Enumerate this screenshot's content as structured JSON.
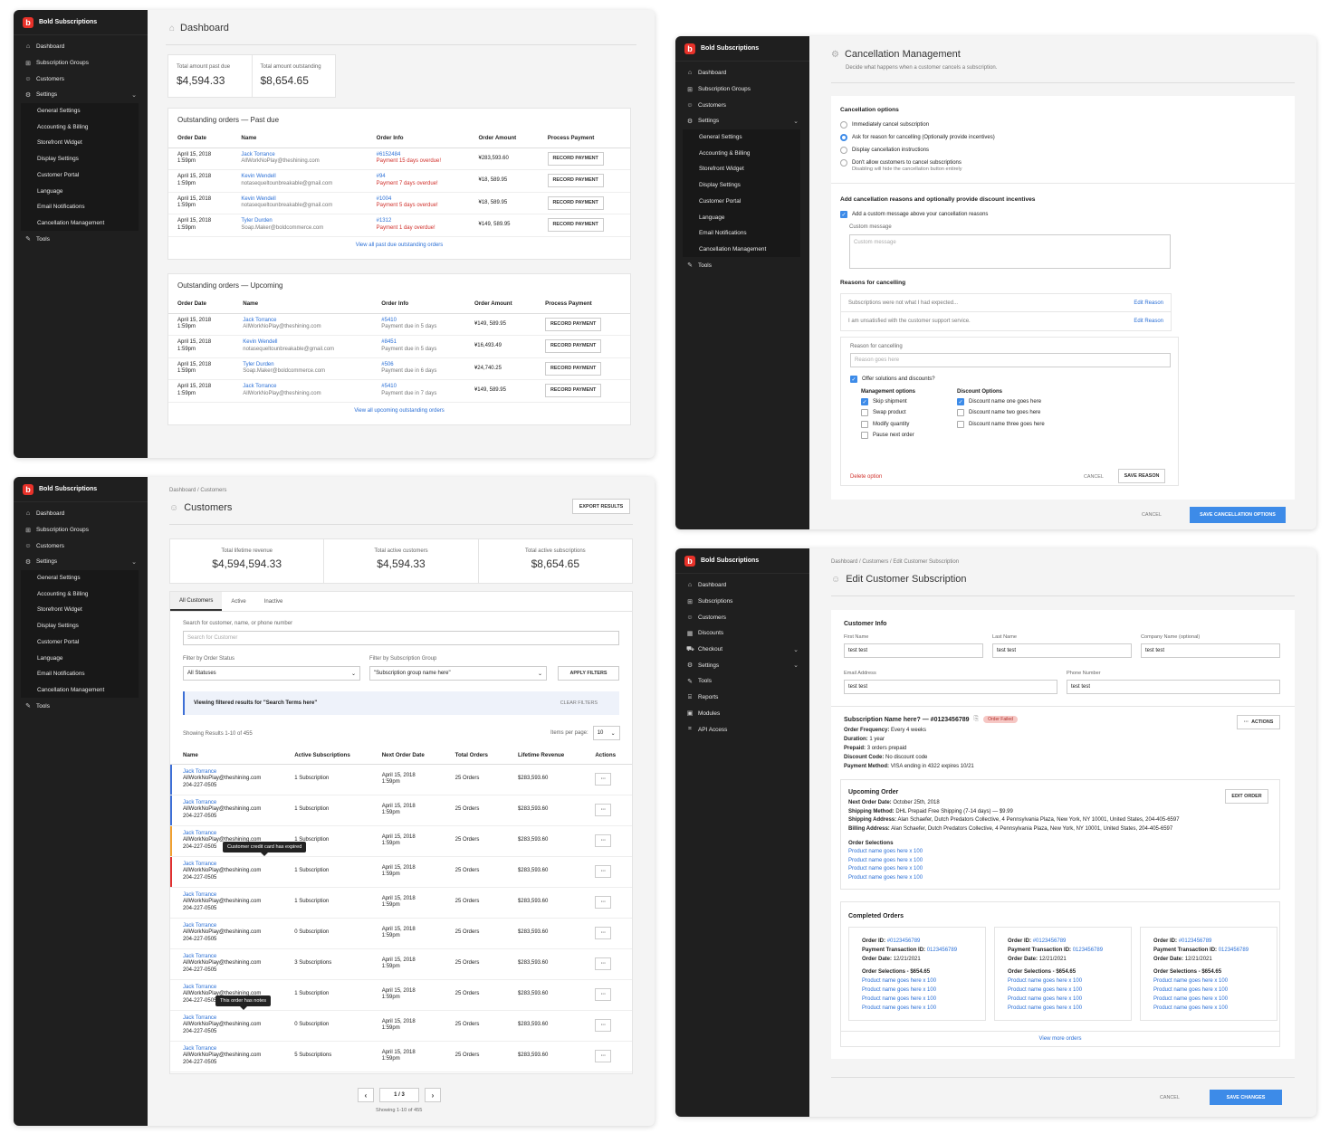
{
  "brand": "Bold Subscriptions",
  "nav": {
    "dashboard": "Dashboard",
    "subscription_groups": "Subscription Groups",
    "customers": "Customers",
    "settings": "Settings",
    "tools": "Tools",
    "subscriptions": "Subscriptions",
    "discounts": "Discounts",
    "checkout": "Checkout",
    "reports": "Reports",
    "modules": "Modules",
    "api_access": "API Access"
  },
  "settings_sub": [
    "General Settings",
    "Accounting & Billing",
    "Storefront Widget",
    "Display Settings",
    "Customer Portal",
    "Language",
    "Email Notifications",
    "Cancellation Management"
  ],
  "dashboard": {
    "title": "Dashboard",
    "stats": [
      {
        "label": "Total amount past due",
        "value": "$4,594.33"
      },
      {
        "label": "Total amount outstanding",
        "value": "$8,654.65"
      }
    ],
    "past_due": {
      "title": "Outstanding orders — Past due",
      "headers": [
        "Order Date",
        "Name",
        "Order Info",
        "Order Amount",
        "Process Payment"
      ],
      "rows": [
        {
          "date": "April 15, 2018",
          "time": "1:59pm",
          "name": "Jack Torrance",
          "email": "AllWorkNoPlay@theshining.com",
          "order": "#6152484",
          "status": "Payment 15 days overdue!",
          "amount": "¥283,593.60",
          "action": "RECORD PAYMENT"
        },
        {
          "date": "April 15, 2018",
          "time": "1:59pm",
          "name": "Kevin Wendell",
          "email": "notasequeltounbreakable@gmail.com",
          "order": "#94",
          "status": "Payment 7 days overdue!",
          "amount": "¥18, 589.95",
          "action": "RECORD PAYMENT"
        },
        {
          "date": "April 15, 2018",
          "time": "1:59pm",
          "name": "Kevin Wendell",
          "email": "notasequeltounbreakable@gmail.com",
          "order": "#1004",
          "status": "Payment 5 days overdue!",
          "amount": "¥18, 589.95",
          "action": "RECORD PAYMENT"
        },
        {
          "date": "April 15, 2018",
          "time": "1:59pm",
          "name": "Tyler Durden",
          "email": "Soap.Maker@boldcommerce.com",
          "order": "#1312",
          "status": "Payment 1 day overdue!",
          "amount": "¥149, 589.95",
          "action": "RECORD PAYMENT"
        }
      ],
      "view_all": "View all past due outstanding orders"
    },
    "upcoming": {
      "title": "Outstanding orders — Upcoming",
      "headers": [
        "Order Date",
        "Name",
        "Order Info",
        "Order Amount",
        "Process Payment"
      ],
      "rows": [
        {
          "date": "April 15, 2018",
          "time": "1:59pm",
          "name": "Jack Torrance",
          "email": "AllWorkNoPlay@theshining.com",
          "order": "#5410",
          "status": "Payment due in 5 days",
          "amount": "¥149, 589.95",
          "action": "RECORD PAYMENT"
        },
        {
          "date": "April 15, 2018",
          "time": "1:59pm",
          "name": "Kevin Wendell",
          "email": "notasequeltounbreakable@gmail.com",
          "order": "#8451",
          "status": "Payment due in 5 days",
          "amount": "¥16,493.49",
          "action": "RECORD PAYMENT"
        },
        {
          "date": "April 15, 2018",
          "time": "1:59pm",
          "name": "Tyler Durden",
          "email": "Soap.Maker@boldcommerce.com",
          "order": "#506",
          "status": "Payment due in 6 days",
          "amount": "¥24,740.25",
          "action": "RECORD PAYMENT"
        },
        {
          "date": "April 15, 2018",
          "time": "1:59pm",
          "name": "Jack Torrance",
          "email": "AllWorkNoPlay@theshining.com",
          "order": "#5410",
          "status": "Payment due in 7 days",
          "amount": "¥149, 589.95",
          "action": "RECORD PAYMENT"
        }
      ],
      "view_all": "View all upcoming outstanding orders"
    }
  },
  "cancel": {
    "title": "Cancellation Management",
    "subtitle": "Decide what happens when a customer cancels a subscription.",
    "options_title": "Cancellation options",
    "options": [
      "Immediately cancel subscription",
      "Ask for reason for cancelling (Optionally provide incentives)",
      "Display cancellation instructions",
      "Don't allow customers to cancel subscriptions"
    ],
    "options_note": "Disabling will hide the cancellation button entirely",
    "reasons_section": "Add cancellation reasons and optionally provide discount incentives",
    "custom_msg_cb": "Add a custom message above your cancellation reasons",
    "custom_msg_label": "Custom message",
    "custom_msg_ph": "Custom message",
    "reasons_title": "Reasons for cancelling",
    "reasons": [
      "Subscriptions were not what I had expected...",
      "I am unsatisfied with the customer support service."
    ],
    "edit_reason": "Edit Reason",
    "reason_label": "Reason for cancelling",
    "reason_ph": "Reason goes here",
    "offer": "Offer solutions and discounts?",
    "mgmt_title": "Management options",
    "mgmt": [
      "Skip shipment",
      "Swap product",
      "Modify quantity",
      "Pause next order"
    ],
    "disc_title": "Discount Options",
    "disc": [
      "Discount name one goes here",
      "Discount name two goes here",
      "Discount name three goes here"
    ],
    "delete": "Delete option",
    "cancel": "CANCEL",
    "save_reason": "SAVE REASON",
    "save": "SAVE CANCELLATION OPTIONS"
  },
  "customers": {
    "crumb": "Dashboard / Customers",
    "title": "Customers",
    "export": "EXPORT RESULTS",
    "stats": [
      {
        "label": "Total lifetime revenue",
        "value": "$4,594,594.33"
      },
      {
        "label": "Total active customers",
        "value": "$4,594.33"
      },
      {
        "label": "Total active subscriptions",
        "value": "$8,654.65"
      }
    ],
    "tabs": [
      "All Customers",
      "Active",
      "Inactive"
    ],
    "search_label": "Search for customer, name, or phone number",
    "search_ph": "Search for Customer",
    "filter_status_label": "Filter by Order Status",
    "filter_status": "All Statuses",
    "filter_group_label": "Filter by Subscription Group",
    "filter_group": "\"Subscription group name here\"",
    "apply": "APPLY FILTERS",
    "banner": "Viewing filtered results for \"Search Terms here\"",
    "clear": "CLEAR FILTERS",
    "showing": "Showing Results 1-10 of 455",
    "per_page_label": "Items per page:",
    "per_page": "10",
    "headers": [
      "Name",
      "Active Subscriptions",
      "Next Order Date",
      "Total Orders",
      "Lifetime Revenue",
      "Actions"
    ],
    "rows": [
      {
        "name": "Jack Torrance",
        "email": "AllWorkNoPlay@theshining.com",
        "phone": "204-227-0505",
        "subs": "1 Subscription",
        "date": "April 15, 2018",
        "time": "1:59pm",
        "orders": "25 Orders",
        "rev": "$283,593.60",
        "flag": "#3d6fd6"
      },
      {
        "name": "Jack Torrance",
        "email": "AllWorkNoPlay@theshining.com",
        "phone": "204-227-0505",
        "subs": "1 Subscription",
        "date": "April 15, 2018",
        "time": "1:59pm",
        "orders": "25 Orders",
        "rev": "$283,593.60",
        "flag": "#3d6fd6"
      },
      {
        "name": "Jack Torrance",
        "email": "AllWorkNoPlay@theshining.com",
        "phone": "204-227-0505",
        "subs": "1 Subscription",
        "date": "April 15, 2018",
        "time": "1:59pm",
        "orders": "25 Orders",
        "rev": "$283,593.60",
        "flag": "#f0a030"
      },
      {
        "name": "Jack Torrance",
        "email": "AllWorkNoPlay@theshining.com",
        "phone": "204-227-0505",
        "subs": "1 Subscription",
        "date": "April 15, 2018",
        "time": "1:59pm",
        "orders": "25 Orders",
        "rev": "$283,593.60",
        "flag": "#e03030"
      },
      {
        "name": "Jack Torrance",
        "email": "AllWorkNoPlay@theshining.com",
        "phone": "204-227-0505",
        "subs": "1 Subscription",
        "date": "April 15, 2018",
        "time": "1:59pm",
        "orders": "25 Orders",
        "rev": "$283,593.60",
        "flag": ""
      },
      {
        "name": "Jack Torrance",
        "email": "AllWorkNoPlay@theshining.com",
        "phone": "204-227-0505",
        "subs": "0 Subscription",
        "date": "April 15, 2018",
        "time": "1:59pm",
        "orders": "25 Orders",
        "rev": "$283,593.60",
        "flag": ""
      },
      {
        "name": "Jack Torrance",
        "email": "AllWorkNoPlay@theshining.com",
        "phone": "204-227-0505",
        "subs": "3 Subscriptions",
        "date": "April 15, 2018",
        "time": "1:59pm",
        "orders": "25 Orders",
        "rev": "$283,593.60",
        "flag": ""
      },
      {
        "name": "Jack Torrance",
        "email": "AllWorkNoPlay@theshining.com",
        "phone": "204-227-0505",
        "subs": "1 Subscription",
        "date": "April 15, 2018",
        "time": "1:59pm",
        "orders": "25 Orders",
        "rev": "$283,593.60",
        "flag": ""
      },
      {
        "name": "Jack Torrance",
        "email": "AllWorkNoPlay@theshining.com",
        "phone": "204-227-0505",
        "subs": "0 Subscription",
        "date": "April 15, 2018",
        "time": "1:59pm",
        "orders": "25 Orders",
        "rev": "$283,593.60",
        "flag": ""
      },
      {
        "name": "Jack Torrance",
        "email": "AllWorkNoPlay@theshining.com",
        "phone": "204-227-0505",
        "subs": "5 Subscriptions",
        "date": "April 15, 2018",
        "time": "1:59pm",
        "orders": "25 Orders",
        "rev": "$283,593.60",
        "flag": ""
      }
    ],
    "tip_card": "Customer credit card has expired",
    "tip_notes": "This order has notes",
    "page": "1 / 3",
    "showing_bottom": "Showing 1-10 of 455"
  },
  "edit": {
    "crumb": "Dashboard / Customers / Edit Customer Subscription",
    "title": "Edit Customer Subscription",
    "info_title": "Customer Info",
    "first_label": "First Name",
    "first": "test test",
    "last_label": "Last Name",
    "last": "test test",
    "company_label": "Company Name (optional)",
    "company": "test test",
    "email_label": "Email Address",
    "email": "test test",
    "phone_label": "Phone Number",
    "phone": "test test",
    "sub_title": "Subscription Name here? — #0123456789",
    "badge": "Order Failed",
    "actions": "ACTIONS",
    "details": [
      [
        "Order Frequency:",
        "Every 4 weeks"
      ],
      [
        "Duration:",
        "1 year"
      ],
      [
        "Prepaid:",
        "3 orders prepaid"
      ],
      [
        "Discount Code:",
        "No discount code"
      ],
      [
        "Payment Method:",
        "VISA ending in 4322 expires 10/21"
      ]
    ],
    "upcoming_title": "Upcoming Order",
    "edit_order": "EDIT ORDER",
    "up_details": [
      [
        "Next Order Date:",
        "October 25th, 2018"
      ],
      [
        "Shipping Method:",
        "DHL Prepaid Free Shipping (7-14 days) — $9.99"
      ],
      [
        "Shipping Address:",
        "Alan Schaefer, Dutch Predators Collective, 4 Pennsylvania Plaza, New York, NY 10001, United States, 204-405-6597"
      ],
      [
        "Billing Address:",
        "Alan Schaefer, Dutch Predators Collective, 4 Pennsylvania Plaza, New York, NY 10001, United States, 204-405-6597"
      ]
    ],
    "sel_title": "Order Selections",
    "sel": [
      "Product name goes here x 100",
      "Product name goes here x 100",
      "Product name goes here x 100",
      "Product name goes here x 100"
    ],
    "completed_title": "Completed Orders",
    "order_id_label": "Order ID:",
    "order_id": "#0123456789",
    "txn_label": "Payment Transaction ID:",
    "txn": "0123456789",
    "odate_label": "Order Date:",
    "odate": "12/21/2021",
    "sel_total": "Order Selections - $654.65",
    "view_more": "View more orders",
    "cancel": "CANCEL",
    "save": "SAVE CHANGES"
  }
}
